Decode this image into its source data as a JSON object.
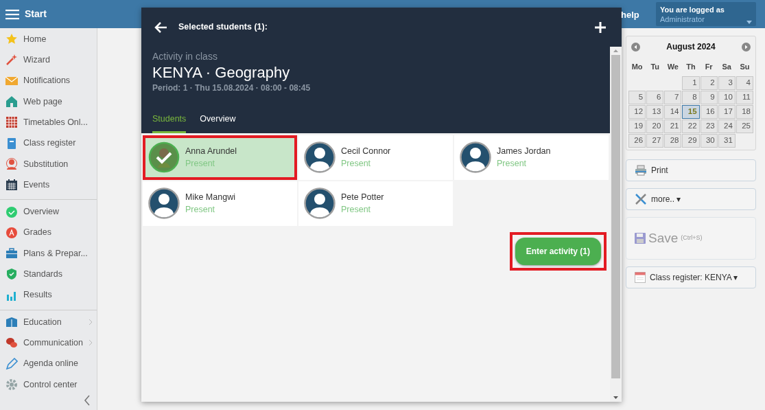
{
  "topbar": {
    "title": "Start",
    "help": "help",
    "login_label": "You are logged as",
    "login_user": "Administrator"
  },
  "sidebar": {
    "groups": [
      [
        {
          "label": "Home",
          "submenu": false
        },
        {
          "label": "Wizard",
          "submenu": false
        },
        {
          "label": "Notifications",
          "submenu": false
        },
        {
          "label": "Web page",
          "submenu": false
        },
        {
          "label": "Timetables Onl...",
          "submenu": false
        },
        {
          "label": "Class register",
          "submenu": false
        },
        {
          "label": "Substitution",
          "submenu": false
        },
        {
          "label": "Events",
          "submenu": false
        }
      ],
      [
        {
          "label": "Overview",
          "submenu": false
        },
        {
          "label": "Grades",
          "submenu": false
        },
        {
          "label": "Plans & Prepar...",
          "submenu": false
        },
        {
          "label": "Standards",
          "submenu": false
        },
        {
          "label": "Results",
          "submenu": false
        }
      ],
      [
        {
          "label": "Education",
          "submenu": true
        },
        {
          "label": "Communication",
          "submenu": true
        },
        {
          "label": "Agenda online",
          "submenu": false
        },
        {
          "label": "Control center",
          "submenu": false
        }
      ]
    ]
  },
  "modal": {
    "toolbar_title": "Selected students (1):",
    "kicker": "Activity in class",
    "title": "KENYA · Geography",
    "period": "Period: 1 · Thu 15.08.2024 · 08:00 - 08:45",
    "tabs": [
      {
        "label": "Students",
        "selected": true
      },
      {
        "label": "Overview",
        "selected": false
      }
    ],
    "students": [
      {
        "name": "Anna Arundel",
        "status": "Present",
        "selected": true
      },
      {
        "name": "Cecil Connor",
        "status": "Present",
        "selected": false
      },
      {
        "name": "James Jordan",
        "status": "Present",
        "selected": false
      },
      {
        "name": "Mike Mangwi",
        "status": "Present",
        "selected": false
      },
      {
        "name": "Pete Potter",
        "status": "Present",
        "selected": false
      }
    ],
    "enter_button": {
      "label": "Enter activity (1)",
      "highlighted": true
    }
  },
  "calendar": {
    "month": "August 2024",
    "weekdays": [
      "Mo",
      "Tu",
      "We",
      "Th",
      "Fr",
      "Sa",
      "Su"
    ],
    "weeks": [
      [
        {
          "kind": "blank"
        },
        {
          "kind": "blank"
        },
        {
          "kind": "blank"
        },
        {
          "kind": "day",
          "day": "1",
          "selected": false
        },
        {
          "day": "2",
          "selected": false
        },
        {
          "day": "3",
          "selected": false
        },
        {
          "day": "4",
          "selected": false
        }
      ],
      [
        {
          "day": "5",
          "selected": false
        },
        {
          "day": "6",
          "selected": false
        },
        {
          "day": "7",
          "selected": false
        },
        {
          "day": "8",
          "selected": false
        },
        {
          "day": "9",
          "selected": false
        },
        {
          "day": "10",
          "selected": false
        },
        {
          "day": "11",
          "selected": false
        }
      ],
      [
        {
          "day": "12",
          "selected": false
        },
        {
          "day": "13",
          "selected": false
        },
        {
          "day": "14",
          "selected": false
        },
        {
          "day": "15",
          "selected": true
        },
        {
          "day": "16",
          "selected": false
        },
        {
          "day": "17",
          "selected": false
        },
        {
          "day": "18",
          "selected": false
        }
      ],
      [
        {
          "day": "19",
          "selected": false
        },
        {
          "day": "20",
          "selected": false
        },
        {
          "day": "21",
          "selected": false
        },
        {
          "day": "22",
          "selected": false
        },
        {
          "day": "23",
          "selected": false
        },
        {
          "day": "24",
          "selected": false
        },
        {
          "day": "25",
          "selected": false
        }
      ],
      [
        {
          "day": "26",
          "selected": false
        },
        {
          "day": "27",
          "selected": false
        },
        {
          "day": "28",
          "selected": false
        },
        {
          "day": "29",
          "selected": false
        },
        {
          "day": "30",
          "selected": false
        },
        {
          "day": "31",
          "selected": false
        },
        {
          "kind": "blank"
        }
      ]
    ]
  },
  "actions": [
    {
      "kind": "print",
      "label": "Print",
      "disabled": false
    },
    {
      "kind": "menu",
      "label": "more.. ▾",
      "disabled": false
    },
    {
      "kind": "save",
      "label": "Save",
      "hint": "(Ctrl+S)",
      "disabled": true
    },
    {
      "kind": "menu",
      "label": "Class register: KENYA ▾",
      "disabled": false
    }
  ]
}
